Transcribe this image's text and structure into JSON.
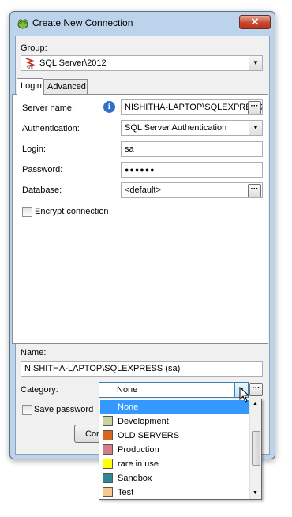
{
  "window": {
    "title": "Create New Connection",
    "close_glyph": "✕"
  },
  "group": {
    "label": "Group:",
    "value": "SQL Server\\2012"
  },
  "tabs": [
    {
      "label": "Login"
    },
    {
      "label": "Advanced"
    }
  ],
  "login_form": {
    "server_name_label": "Server name:",
    "server_name_value": "NISHITHA-LAPTOP\\SQLEXPRESS",
    "authentication_label": "Authentication:",
    "authentication_value": "SQL Server Authentication",
    "login_label": "Login:",
    "login_value": "sa",
    "password_label": "Password:",
    "password_value": "●●●●●●",
    "database_label": "Database:",
    "database_value": "<default>",
    "encrypt_label": "Encrypt connection"
  },
  "name": {
    "label": "Name:",
    "value": "NISHITHA-LAPTOP\\SQLEXPRESS (sa)"
  },
  "category": {
    "label": "Category:",
    "value": "None",
    "options": [
      {
        "label": "None",
        "color": "",
        "selected": true
      },
      {
        "label": "Development",
        "color": "#c5d4a0"
      },
      {
        "label": "OLD SERVERS",
        "color": "#d9661f"
      },
      {
        "label": "Production",
        "color": "#d67b8a"
      },
      {
        "label": "rare in use",
        "color": "#ffff00"
      },
      {
        "label": "Sandbox",
        "color": "#2b8a95"
      },
      {
        "label": "Test",
        "color": "#f7c98a"
      }
    ]
  },
  "save_password_label": "Save password",
  "connect_button_partial": "Con",
  "ellipsis": "···",
  "arrow_down": "▼",
  "info_glyph": "i"
}
